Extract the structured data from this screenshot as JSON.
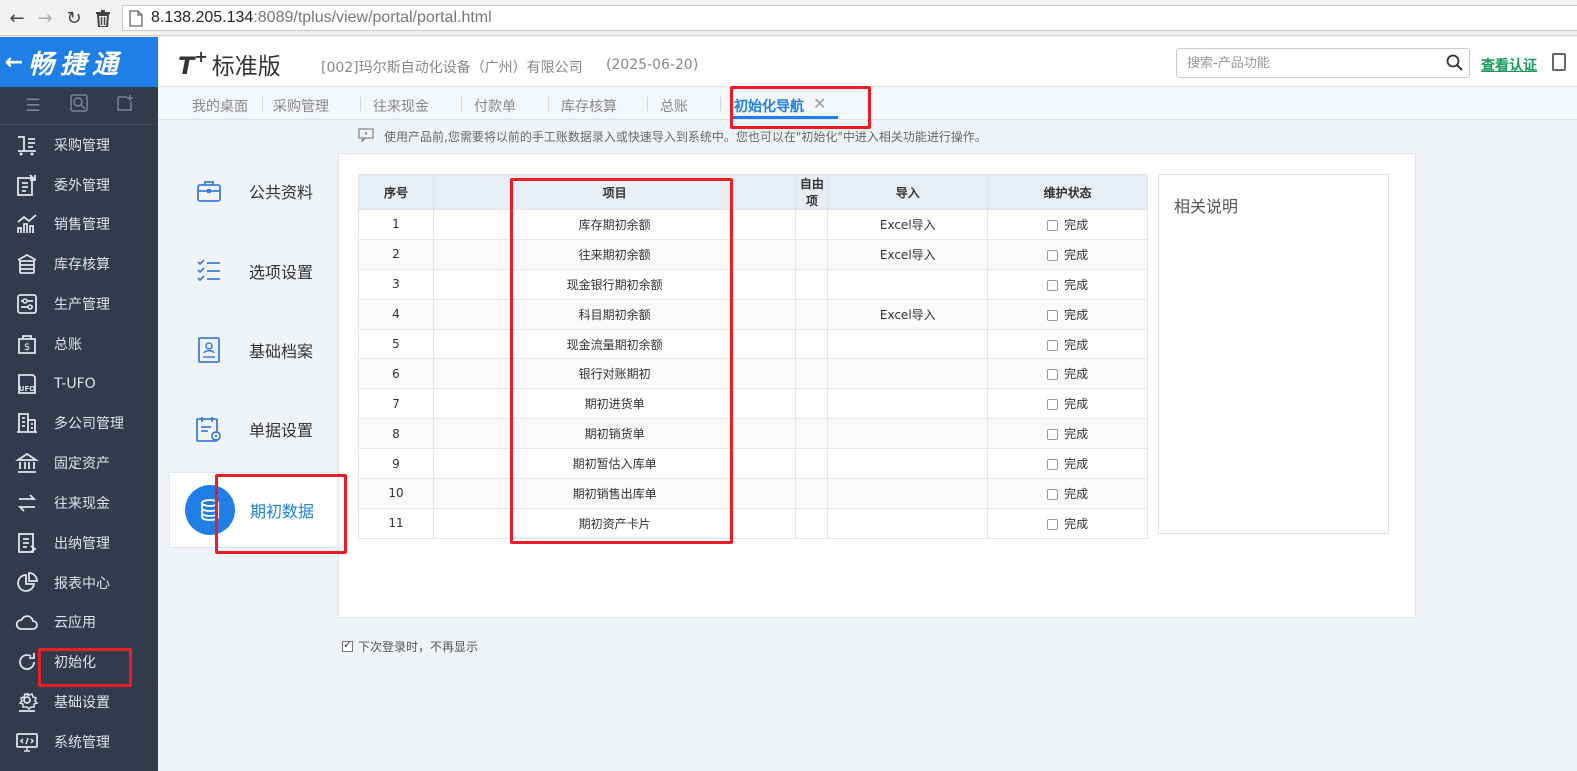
{
  "browser": {
    "url_host": "8.138.205.134",
    "url_rest": ":8089/tplus/view/portal/portal.html"
  },
  "sidebar": {
    "brand": "畅捷通",
    "items": [
      {
        "label": "采购管理",
        "icon": "purchase-icon"
      },
      {
        "label": "委外管理",
        "icon": "outsource-icon"
      },
      {
        "label": "销售管理",
        "icon": "sales-chart-icon"
      },
      {
        "label": "库存核算",
        "icon": "inventory-icon"
      },
      {
        "label": "生产管理",
        "icon": "production-icon"
      },
      {
        "label": "总账",
        "icon": "ledger-icon"
      },
      {
        "label": "T-UFO",
        "icon": "ufo-icon"
      },
      {
        "label": "多公司管理",
        "icon": "building-icon"
      },
      {
        "label": "固定资产",
        "icon": "bank-icon"
      },
      {
        "label": "往来现金",
        "icon": "transfer-arrows-icon"
      },
      {
        "label": "出纳管理",
        "icon": "cashier-icon"
      },
      {
        "label": "报表中心",
        "icon": "pie-chart-icon"
      },
      {
        "label": "云应用",
        "icon": "cloud-icon"
      },
      {
        "label": "初始化",
        "icon": "refresh-icon"
      },
      {
        "label": "基础设置",
        "icon": "gear-icon"
      },
      {
        "label": "系统管理",
        "icon": "monitor-icon"
      }
    ]
  },
  "header": {
    "logo": "T",
    "logo_plus": "+",
    "edition": "标准版",
    "company": "[002]玛尔斯自动化设备（广州）有限公司",
    "date": "(2025-06-20)",
    "search_placeholder": "搜索-产品功能",
    "verify_link": "查看认证"
  },
  "tabs": [
    {
      "label": "我的桌面"
    },
    {
      "label": "采购管理"
    },
    {
      "label": "往来现金"
    },
    {
      "label": "付款单"
    },
    {
      "label": "库存核算"
    },
    {
      "label": "总账"
    },
    {
      "label": "初始化导航"
    }
  ],
  "notice": "使用产品前,您需要将以前的手工账数据录入或快速导入到系统中。您也可以在\"初始化\"中进入相关功能进行操作。",
  "categories": [
    {
      "label": "公共资料"
    },
    {
      "label": "选项设置"
    },
    {
      "label": "基础档案"
    },
    {
      "label": "单据设置"
    },
    {
      "label": "期初数据"
    }
  ],
  "table": {
    "headers": [
      "序号",
      "项目",
      "自由项",
      "导入",
      "维护状态"
    ],
    "rows": [
      {
        "no": "1",
        "item": "库存期初余额",
        "free": "",
        "import": "Excel导入",
        "status": "完成"
      },
      {
        "no": "2",
        "item": "往来期初余额",
        "free": "",
        "import": "Excel导入",
        "status": "完成"
      },
      {
        "no": "3",
        "item": "现金银行期初余额",
        "free": "",
        "import": "",
        "status": "完成"
      },
      {
        "no": "4",
        "item": "科目期初余额",
        "free": "",
        "import": "Excel导入",
        "status": "完成"
      },
      {
        "no": "5",
        "item": "现金流量期初余额",
        "free": "",
        "import": "",
        "status": "完成"
      },
      {
        "no": "6",
        "item": "银行对账期初",
        "free": "",
        "import": "",
        "status": "完成"
      },
      {
        "no": "7",
        "item": "期初进货单",
        "free": "",
        "import": "",
        "status": "完成"
      },
      {
        "no": "8",
        "item": "期初销货单",
        "free": "",
        "import": "",
        "status": "完成"
      },
      {
        "no": "9",
        "item": "期初暂估入库单",
        "free": "",
        "import": "",
        "status": "完成"
      },
      {
        "no": "10",
        "item": "期初销售出库单",
        "free": "",
        "import": "",
        "status": "完成"
      },
      {
        "no": "11",
        "item": "期初资产卡片",
        "free": "",
        "import": "",
        "status": "完成"
      }
    ]
  },
  "help": {
    "title": "相关说明"
  },
  "footer": {
    "dont_show_label": "下次登录时，不再显示"
  },
  "colors": {
    "accent": "#1f7fe6",
    "sidebar": "#313b4b",
    "annotation": "#ee1c24",
    "verify": "#1a9a5a"
  }
}
